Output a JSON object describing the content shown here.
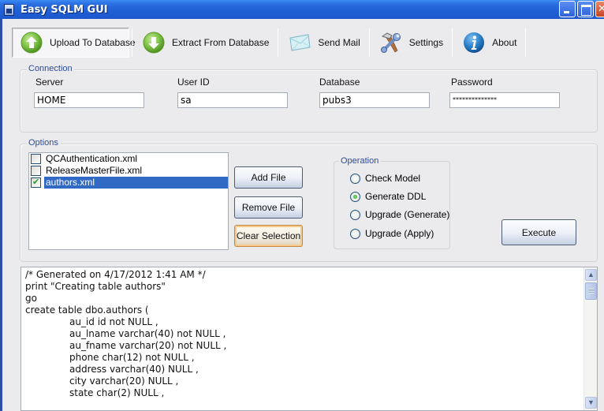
{
  "window": {
    "title": "Easy SQLM GUI",
    "controls": [
      "minimize",
      "maximize",
      "close"
    ]
  },
  "toolbar": {
    "items": [
      {
        "label": "Upload To Database",
        "icon": "upload-arrow-icon",
        "active": true
      },
      {
        "label": "Extract From Database",
        "icon": "download-arrow-icon",
        "active": false
      },
      {
        "label": "Send Mail",
        "icon": "envelope-icon",
        "active": false
      },
      {
        "label": "Settings",
        "icon": "tools-icon",
        "active": false
      },
      {
        "label": "About",
        "icon": "info-icon",
        "active": false
      }
    ]
  },
  "connection": {
    "legend": "Connection",
    "server": {
      "label": "Server",
      "value": "HOME"
    },
    "user_id": {
      "label": "User ID",
      "value": "sa"
    },
    "database": {
      "label": "Database",
      "value": "pubs3"
    },
    "password": {
      "label": "Password",
      "value": "**************"
    }
  },
  "options": {
    "legend": "Options",
    "files": [
      {
        "name": "QCAuthentication.xml",
        "checked": false,
        "selected": false
      },
      {
        "name": "ReleaseMasterFile.xml",
        "checked": false,
        "selected": false
      },
      {
        "name": "authors.xml",
        "checked": true,
        "selected": true
      }
    ],
    "buttons": {
      "add_file": "Add File",
      "remove_file": "Remove File",
      "clear_selection": "Clear Selection"
    },
    "operation": {
      "legend": "Operation",
      "choices": [
        {
          "label": "Check Model",
          "checked": false
        },
        {
          "label": "Generate DDL",
          "checked": true
        },
        {
          "label": "Upgrade (Generate)",
          "checked": false
        },
        {
          "label": "Upgrade (Apply)",
          "checked": false
        }
      ]
    },
    "execute": "Execute"
  },
  "output": {
    "lines": [
      "/* Generated on 4/17/2012 1:41 AM */",
      "print \"Creating table authors\"",
      "go",
      "create table dbo.authors (",
      "\t\tau_id id not NULL ,",
      "\t\tau_lname varchar(40) not NULL ,",
      "\t\tau_fname varchar(20) not NULL ,",
      "\t\tphone char(12) not NULL ,",
      "\t\taddress varchar(40) NULL ,",
      "\t\tcity varchar(20) NULL ,",
      "\t\tstate char(2) NULL ,"
    ]
  },
  "colors": {
    "titlebar": "#1f5ed4",
    "selection": "#316ac5",
    "legend_text": "#2a4d9c",
    "window_bg": "#ebeaed"
  }
}
